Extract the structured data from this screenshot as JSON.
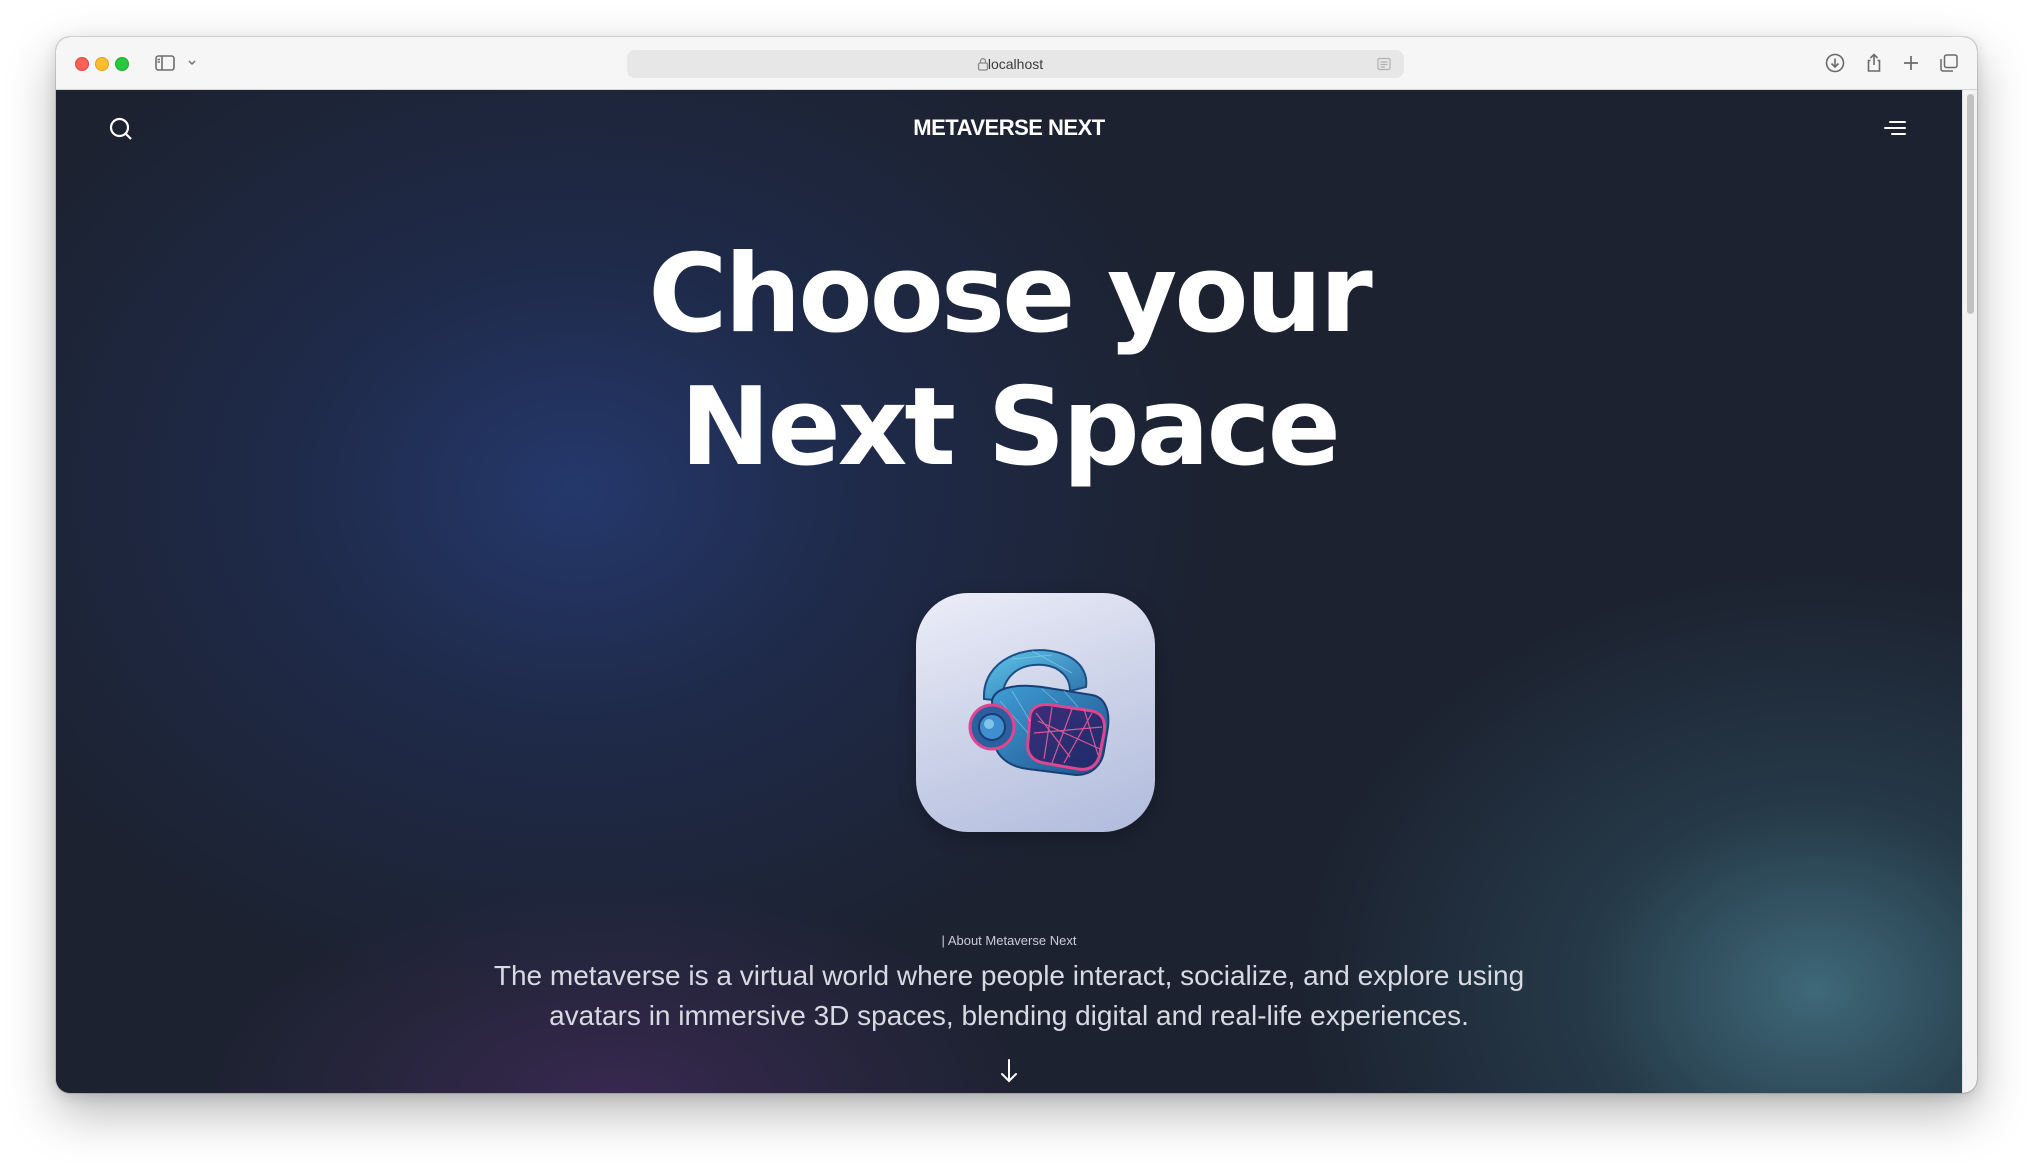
{
  "browser": {
    "address": "localhost"
  },
  "site": {
    "brand": "METAVERSE NEXT",
    "hero": {
      "line1": "Choose your",
      "line2": "Next Space"
    },
    "about": {
      "label": "| About Metaverse Next",
      "text": "The metaverse is a virtual world where people interact, socialize, and explore using avatars in immersive 3D spaces, blending digital and real-life experiences."
    }
  },
  "icons": {
    "search": "search-icon",
    "menu": "menu-icon",
    "app_icon": "vr-headset-icon",
    "scroll": "arrow-down-icon"
  },
  "colors": {
    "page_background": "#1c2230",
    "blue_glow": "#263c76",
    "teal_glow": "#406c7c",
    "text_primary": "#ffffff",
    "text_secondary": "#d7dae2"
  }
}
